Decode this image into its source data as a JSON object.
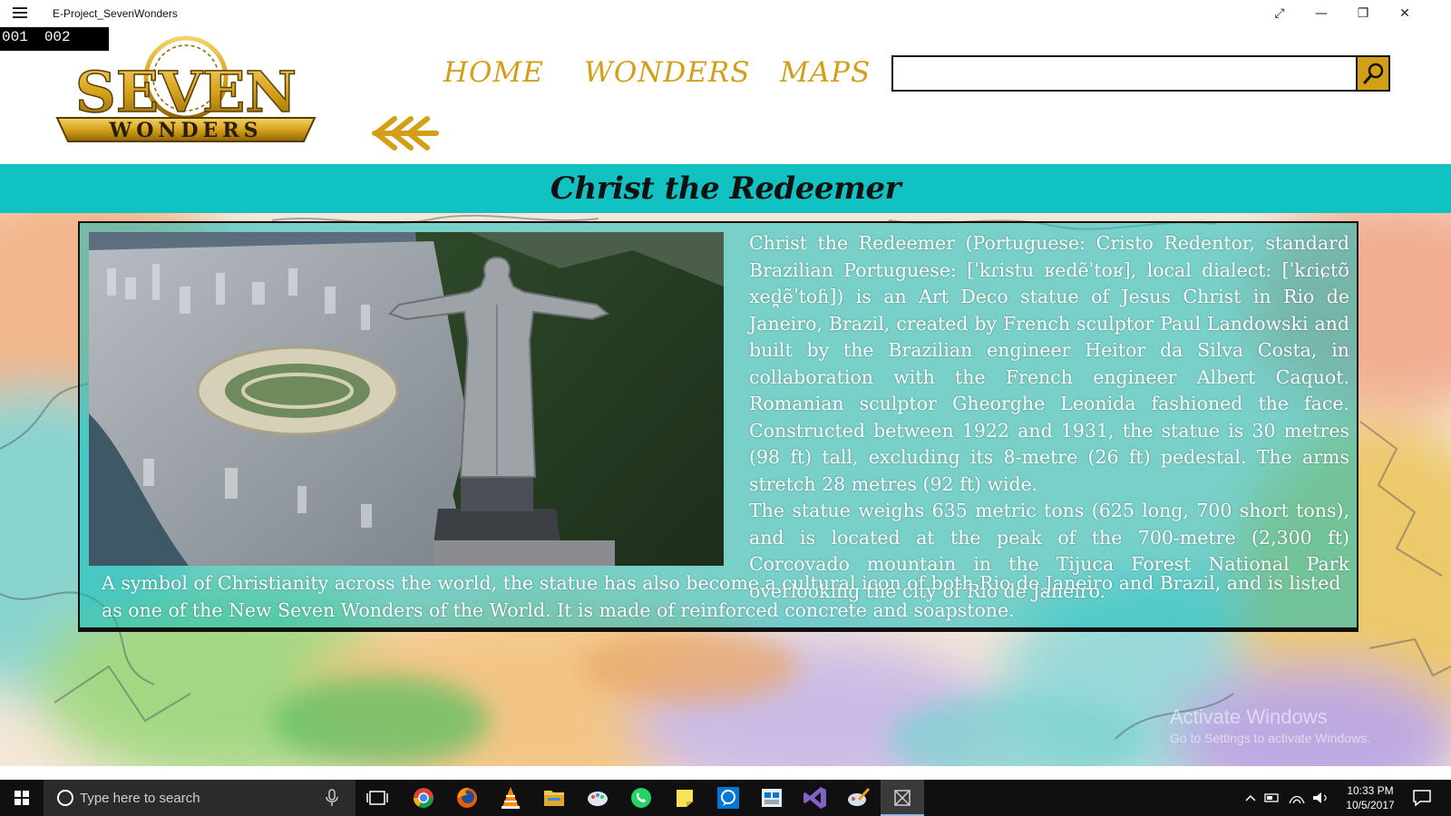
{
  "window": {
    "title": "E-Project_SevenWonders",
    "buttons": [
      "fullscreen",
      "minimize",
      "restore",
      "close"
    ]
  },
  "debug_counter": [
    "001",
    "002"
  ],
  "header": {
    "logo_top": "SEVEN",
    "logo_bottom": "WONDERS",
    "nav": [
      "HOME",
      "WONDERS",
      "MAPS"
    ],
    "search": {
      "value": "",
      "placeholder": ""
    }
  },
  "page": {
    "title": "Christ the Redeemer",
    "paragraph_1": "Christ the Redeemer (Portuguese: Cristo Redentor, standard Brazilian Portuguese: [ˈkɾistu ʁedẽˈtoʁ], local dialect: [ˈkɾiɕtʊ̃ xed̪ẽˈtoɦ]) is an Art Deco statue of Jesus Christ in Rio de Janeiro, Brazil, created by French sculptor Paul Landowski and built by the Brazilian engineer Heitor da Silva Costa, in collaboration with the French engineer Albert Caquot. Romanian sculptor Gheorghe Leonida fashioned the face. Constructed between 1922 and 1931, the statue is 30 metres (98 ft) tall, excluding its 8-metre (26 ft) pedestal. The arms stretch 28 metres (92 ft) wide.",
    "paragraph_2": "The statue weighs 635 metric tons (625 long, 700 short tons), and is located at the peak of the 700-metre (2,300 ft) Corcovado mountain in the Tijuca Forest National Park overlooking the city of Rio de Janeiro.",
    "paragraph_3": "A symbol of Christianity across the world, the statue has also become a cultural icon of both Rio de Janeiro and Brazil, and is listed as one of the New Seven Wonders of the World. It is made of reinforced concrete and soapstone."
  },
  "watermark": {
    "line1": "Activate Windows",
    "line2": "Go to Settings to activate Windows."
  },
  "taskbar": {
    "search_placeholder": "Type here to search",
    "apps": [
      "chrome-icon",
      "firefox-icon",
      "vlc-icon",
      "file-explorer-icon",
      "paint-icon",
      "whatsapp-icon",
      "sticky-notes-icon",
      "messaging-icon",
      "store-icon",
      "visual-studio-icon",
      "paint-brush-icon",
      "app-window-icon"
    ],
    "time": "10:33 PM",
    "date": "10/5/2017"
  },
  "colors": {
    "gold": "#d39f16",
    "teal": "#10c3c2",
    "taskbar": "#101010"
  }
}
